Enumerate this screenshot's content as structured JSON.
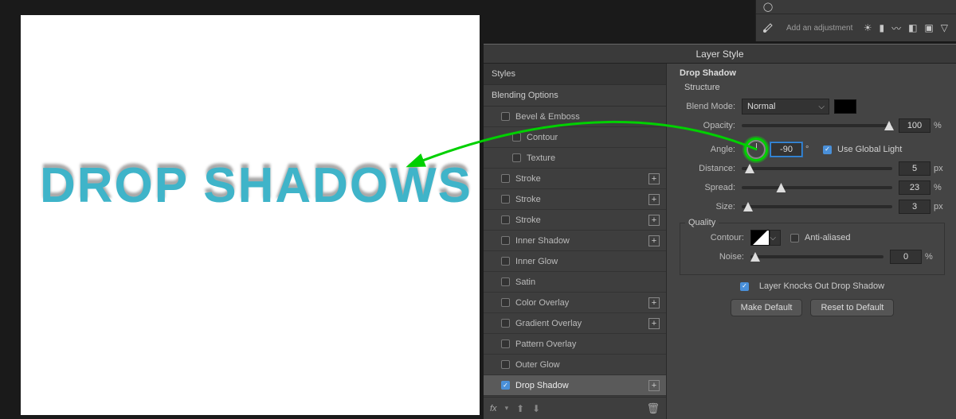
{
  "canvas": {
    "text": "DROP SHADOWS"
  },
  "adjustments": {
    "label": "Add an adjustment",
    "icons": [
      "sun-icon",
      "levels-icon",
      "curves-icon",
      "exposure-icon",
      "photo-icon",
      "triangle-icon"
    ]
  },
  "dialog": {
    "title": "Layer Style"
  },
  "styles": {
    "header": "Styles",
    "blending": "Blending Options",
    "items": [
      {
        "label": "Bevel & Emboss",
        "checked": false,
        "plus": false,
        "indent": 1
      },
      {
        "label": "Contour",
        "checked": false,
        "plus": false,
        "indent": 2
      },
      {
        "label": "Texture",
        "checked": false,
        "plus": false,
        "indent": 2
      },
      {
        "label": "Stroke",
        "checked": false,
        "plus": true,
        "indent": 1
      },
      {
        "label": "Stroke",
        "checked": false,
        "plus": true,
        "indent": 1
      },
      {
        "label": "Stroke",
        "checked": false,
        "plus": true,
        "indent": 1
      },
      {
        "label": "Inner Shadow",
        "checked": false,
        "plus": true,
        "indent": 1
      },
      {
        "label": "Inner Glow",
        "checked": false,
        "plus": false,
        "indent": 1
      },
      {
        "label": "Satin",
        "checked": false,
        "plus": false,
        "indent": 1
      },
      {
        "label": "Color Overlay",
        "checked": false,
        "plus": true,
        "indent": 1
      },
      {
        "label": "Gradient Overlay",
        "checked": false,
        "plus": true,
        "indent": 1
      },
      {
        "label": "Pattern Overlay",
        "checked": false,
        "plus": false,
        "indent": 1
      },
      {
        "label": "Outer Glow",
        "checked": false,
        "plus": false,
        "indent": 1
      },
      {
        "label": "Drop Shadow",
        "checked": true,
        "plus": true,
        "indent": 1,
        "selected": true
      }
    ],
    "footer_fx": "fx"
  },
  "settings": {
    "title": "Drop Shadow",
    "structure_label": "Structure",
    "blend_mode_label": "Blend Mode:",
    "blend_mode_value": "Normal",
    "opacity_label": "Opacity:",
    "opacity_value": "100",
    "opacity_unit": "%",
    "angle_label": "Angle:",
    "angle_value": "-90",
    "angle_unit": "°",
    "global_light_label": "Use Global Light",
    "global_light_checked": true,
    "distance_label": "Distance:",
    "distance_value": "5",
    "distance_unit": "px",
    "spread_label": "Spread:",
    "spread_value": "23",
    "spread_unit": "%",
    "size_label": "Size:",
    "size_value": "3",
    "size_unit": "px",
    "quality_label": "Quality",
    "contour_label": "Contour:",
    "antialiased_label": "Anti-aliased",
    "antialiased_checked": false,
    "noise_label": "Noise:",
    "noise_value": "0",
    "noise_unit": "%",
    "knockout_label": "Layer Knocks Out Drop Shadow",
    "knockout_checked": true,
    "make_default": "Make Default",
    "reset_default": "Reset to Default"
  }
}
